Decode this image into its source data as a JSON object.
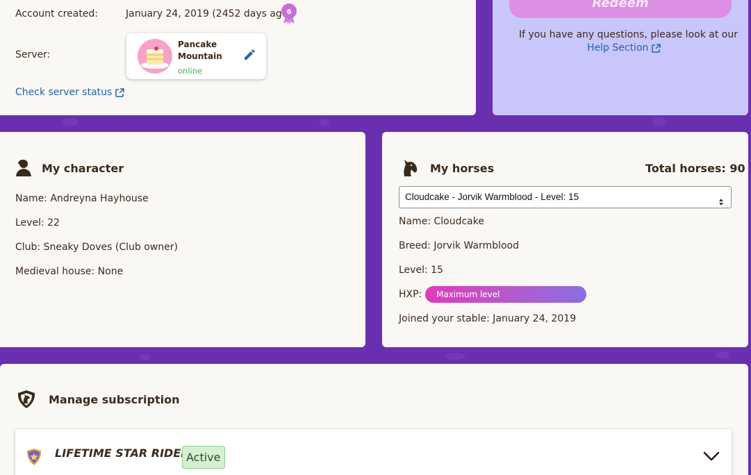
{
  "account": {
    "created_label": "Account created:",
    "created_value": "January 24, 2019 (2452 days ago)",
    "badge_number": "6",
    "server_label": "Server:",
    "server_name": "Pancake Mountain",
    "server_status": "online",
    "check_status_link": "Check server status"
  },
  "redeem": {
    "button_label": "Redeem",
    "help_text": "If you have any questions, please look at our",
    "help_link": "Help Section"
  },
  "character": {
    "title": "My character",
    "name": "Name: Andreyna Hayhouse",
    "level": "Level: 22",
    "club": "Club: Sneaky Doves (Club owner)",
    "medieval_house": "Medieval house: None"
  },
  "horses": {
    "title": "My horses",
    "total": "Total horses: 90",
    "selected": "Cloudcake - Jorvik Warmblood - Level: 15",
    "name": "Name: Cloudcake",
    "breed": "Breed: Jorvik Warmblood",
    "level": "Level: 15",
    "hxp_label": "HXP:",
    "hxp_value": "Maximum level",
    "joined": "Joined your stable: January 24, 2019"
  },
  "subscription": {
    "title": "Manage subscription",
    "plan_name": "LIFETIME STAR RIDER",
    "status": "Active"
  },
  "colors": {
    "background": "#6a2fb0",
    "card": "#faf8f4",
    "redeem_card": "#c9c6fb",
    "link": "#1f63a8",
    "online": "#3bb54a"
  }
}
